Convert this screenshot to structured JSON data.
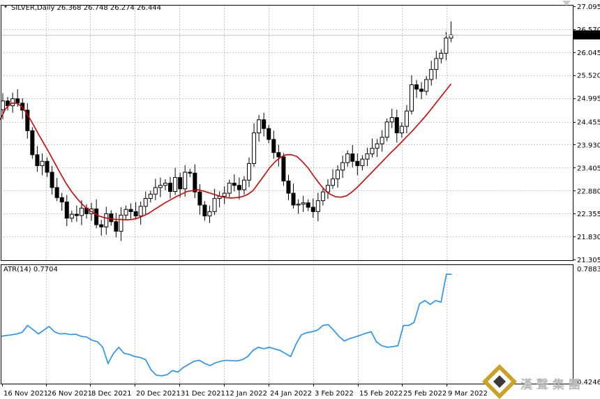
{
  "colors": {
    "background": "#ffffff",
    "grid": "#c8c8c8",
    "axis": "#000000",
    "ma_line": "#d40000",
    "atr_line": "#1e90ff",
    "candle_up_body": "#ffffff",
    "candle_down_body": "#000000",
    "price_tag_bg": "#000000",
    "price_tag_text": "#ffffff",
    "watermark": "#b9b9b9"
  },
  "header": {
    "main_title": "SILVER,Daily  26.368 26.748 26.274 26.444",
    "atr_title": "ATR(14) 0.7704"
  },
  "watermark": {
    "text": "漢 聲 集 團",
    "icon": "diamond-logo-icon"
  },
  "chart_data": [
    {
      "type": "candlestick",
      "symbol": "SILVER",
      "timeframe": "Daily",
      "ohlc_last": {
        "open": 26.368,
        "high": 26.748,
        "low": 26.274,
        "close": 26.444
      },
      "current_price_label": "26.444",
      "y_range": [
        21.305,
        27.095
      ],
      "y_ticks": [
        "27.095",
        "26.570",
        "26.045",
        "25.520",
        "24.995",
        "24.455",
        "23.930",
        "23.405",
        "22.880",
        "22.355",
        "21.830",
        "21.305"
      ],
      "y_tick_values": [
        27.095,
        26.57,
        26.045,
        25.52,
        24.995,
        24.455,
        23.93,
        23.405,
        22.88,
        22.355,
        21.83,
        21.305
      ],
      "grid": true,
      "close": [
        24.93,
        24.82,
        24.98,
        24.88,
        24.72,
        24.25,
        23.7,
        23.45,
        23.55,
        23.3,
        22.95,
        22.72,
        22.62,
        22.25,
        22.34,
        22.31,
        22.48,
        22.35,
        22.46,
        22.1,
        22.05,
        22.35,
        22.17,
        21.95,
        22.32,
        22.45,
        22.4,
        22.3,
        22.52,
        22.7,
        22.8,
        22.95,
        23.0,
        23.05,
        22.86,
        23.18,
        22.92,
        23.3,
        23.28,
        22.85,
        22.55,
        22.3,
        22.4,
        22.7,
        22.75,
        22.82,
        23.05,
        23.0,
        22.9,
        23.12,
        23.5,
        24.2,
        24.5,
        24.3,
        24.05,
        23.75,
        23.65,
        23.1,
        22.82,
        22.55,
        22.57,
        22.6,
        22.5,
        22.4,
        22.65,
        22.85,
        23.0,
        23.15,
        23.35,
        23.52,
        23.72,
        23.55,
        23.45,
        23.6,
        23.72,
        23.85,
        23.95,
        24.1,
        24.45,
        24.55,
        24.2,
        24.35,
        24.7,
        25.3,
        25.2,
        25.15,
        25.42,
        25.65,
        25.9,
        26.02,
        26.37,
        26.44
      ],
      "ma_line_values": [
        24.5,
        24.75,
        24.88,
        24.88,
        24.8,
        24.62,
        24.4,
        24.17,
        23.95,
        23.73,
        23.5,
        23.27,
        23.05,
        22.86,
        22.7,
        22.56,
        22.45,
        22.37,
        22.3,
        22.26,
        22.24,
        22.22,
        22.22,
        22.21,
        22.22,
        22.25,
        22.3,
        22.36,
        22.44,
        22.52,
        22.6,
        22.67,
        22.74,
        22.8,
        22.86,
        22.88,
        22.9,
        22.87,
        22.83,
        22.79,
        22.75,
        22.72,
        22.71,
        22.72,
        22.74,
        22.79,
        22.88,
        23.05,
        23.22,
        23.4,
        23.54,
        23.64,
        23.7,
        23.7,
        23.66,
        23.54,
        23.4,
        23.22,
        23.05,
        22.9,
        22.8,
        22.74,
        22.73,
        22.76,
        22.85,
        22.96,
        23.09,
        23.22,
        23.35,
        23.48,
        23.61,
        23.74,
        23.86,
        23.99,
        24.12,
        24.25,
        24.39,
        24.53,
        24.68,
        24.84,
        25.0,
        25.16,
        25.32
      ]
    },
    {
      "type": "line",
      "title": "ATR(14) 0.7704",
      "y_range": [
        0.4246,
        0.7883
      ],
      "y_ticks": [
        "0.7883",
        "0.4246"
      ],
      "y_tick_values": [
        0.7883,
        0.4246
      ],
      "values": [
        0.57,
        0.573,
        0.575,
        0.578,
        0.583,
        0.605,
        0.592,
        0.578,
        0.59,
        0.602,
        0.585,
        0.578,
        0.579,
        0.576,
        0.577,
        0.57,
        0.568,
        0.558,
        0.553,
        0.535,
        0.483,
        0.515,
        0.535,
        0.515,
        0.512,
        0.505,
        0.502,
        0.495,
        0.462,
        0.445,
        0.443,
        0.447,
        0.46,
        0.455,
        0.47,
        0.48,
        0.49,
        0.493,
        0.483,
        0.476,
        0.485,
        0.49,
        0.493,
        0.492,
        0.491,
        0.495,
        0.505,
        0.525,
        0.535,
        0.53,
        0.535,
        0.53,
        0.525,
        0.515,
        0.505,
        0.545,
        0.575,
        0.582,
        0.585,
        0.59,
        0.605,
        0.608,
        0.59,
        0.57,
        0.555,
        0.563,
        0.568,
        0.574,
        0.58,
        0.585,
        0.552,
        0.54,
        0.535,
        0.537,
        0.54,
        0.605,
        0.605,
        0.615,
        0.675,
        0.685,
        0.673,
        0.685,
        0.68,
        0.77,
        0.77
      ]
    }
  ],
  "x_axis": {
    "labels": [
      "16 Nov 2021",
      "26 Nov 2021",
      "8 Dec 2021",
      "20 Dec 2021",
      "31 Dec 2021",
      "12 Jan 2022",
      "24 Jan 2022",
      "3 Feb 2022",
      "15 Feb 2022",
      "25 Feb 2022",
      "9 Mar 2022"
    ]
  }
}
